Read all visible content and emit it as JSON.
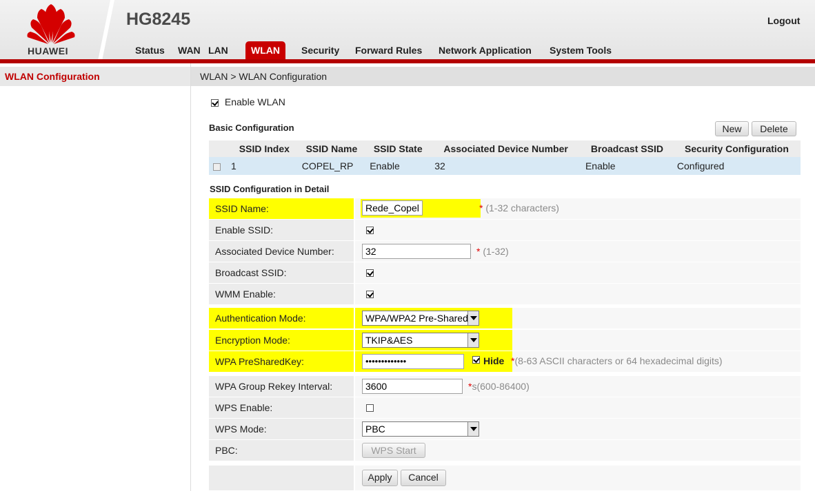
{
  "header": {
    "brand": "HUAWEI",
    "model": "HG8245",
    "logout_label": "Logout",
    "brand_color": "#c90000"
  },
  "nav": {
    "items": [
      "Status",
      "WAN",
      "LAN",
      "WLAN",
      "Security",
      "Forward Rules",
      "Network Application",
      "System Tools"
    ],
    "active": "WLAN"
  },
  "sidebar": {
    "items": [
      {
        "label": "WLAN Configuration"
      }
    ]
  },
  "breadcrumb": "WLAN > WLAN Configuration",
  "enable_wlan": {
    "label": "Enable WLAN",
    "checked": true
  },
  "basic": {
    "title": "Basic Configuration",
    "new_label": "New",
    "delete_label": "Delete",
    "columns": [
      "SSID Index",
      "SSID Name",
      "SSID State",
      "Associated Device Number",
      "Broadcast SSID",
      "Security Configuration"
    ],
    "rows": [
      {
        "index": "1",
        "name": "COPEL_RP",
        "state": "Enable",
        "devices": "32",
        "broadcast": "Enable",
        "security": "Configured"
      }
    ]
  },
  "detail": {
    "title": "SSID Configuration in Detail",
    "ssid_name": {
      "label": "SSID Name:",
      "value": "Rede_Copel",
      "star": "*",
      "hint": "(1-32 characters)"
    },
    "enable_ssid": {
      "label": "Enable SSID:",
      "checked": true
    },
    "assoc_devices": {
      "label": "Associated Device Number:",
      "value": "32",
      "star": "*",
      "hint": "(1-32)"
    },
    "broadcast_ssid": {
      "label": "Broadcast SSID:",
      "checked": true
    },
    "wmm_enable": {
      "label": "WMM Enable:",
      "checked": true
    },
    "auth_mode": {
      "label": "Authentication Mode:",
      "value": "WPA/WPA2 Pre-Shared"
    },
    "enc_mode": {
      "label": "Encryption Mode:",
      "value": "TKIP&AES"
    },
    "psk": {
      "label": "WPA PreSharedKey:",
      "value": "•••••••••••••",
      "hide_label": "Hide",
      "star": "*",
      "hint": "(8-63 ASCII characters or 64 hexadecimal digits)"
    },
    "rekey": {
      "label": "WPA Group Rekey Interval:",
      "value": "3600",
      "star": "*",
      "hint": "s(600-86400)"
    },
    "wps_enable": {
      "label": "WPS Enable:",
      "checked": false
    },
    "wps_mode": {
      "label": "WPS Mode:",
      "value": "PBC"
    },
    "pbc": {
      "label": "PBC:",
      "button": "WPS Start"
    }
  },
  "actions": {
    "apply": "Apply",
    "cancel": "Cancel"
  }
}
